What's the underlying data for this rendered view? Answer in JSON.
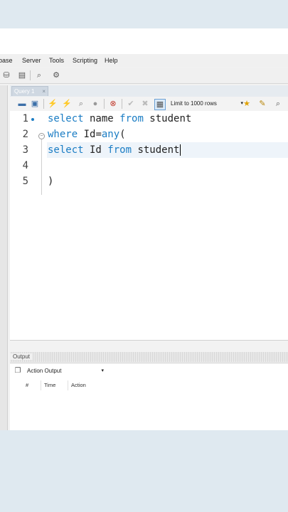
{
  "menu": [
    "base",
    "Server",
    "Tools",
    "Scripting",
    "Help"
  ],
  "tab": {
    "label": "Query 1",
    "close": "×"
  },
  "editor_toolbar": {
    "limit_label": "Limit to 1000 rows",
    "arrow": "▾"
  },
  "code": {
    "line_numbers": [
      "1",
      "2",
      "3",
      "4",
      "5"
    ],
    "line1": {
      "kw1": "select",
      "t1": " name ",
      "kw2": "from",
      "t2": " student"
    },
    "line2": {
      "kw1": "where",
      "t1": " Id=",
      "kw2": "any",
      "t2": "("
    },
    "line3": {
      "kw1": "select",
      "t1": " Id ",
      "kw2": "from",
      "t2": " student"
    },
    "line5": ")"
  },
  "output": {
    "header": "Output",
    "selector": "Action Output",
    "arrow": "▾",
    "columns": [
      "#",
      "Time",
      "Action"
    ]
  },
  "colors": {
    "keyword": "#1b7dc4",
    "background": "#dfe9f0"
  }
}
